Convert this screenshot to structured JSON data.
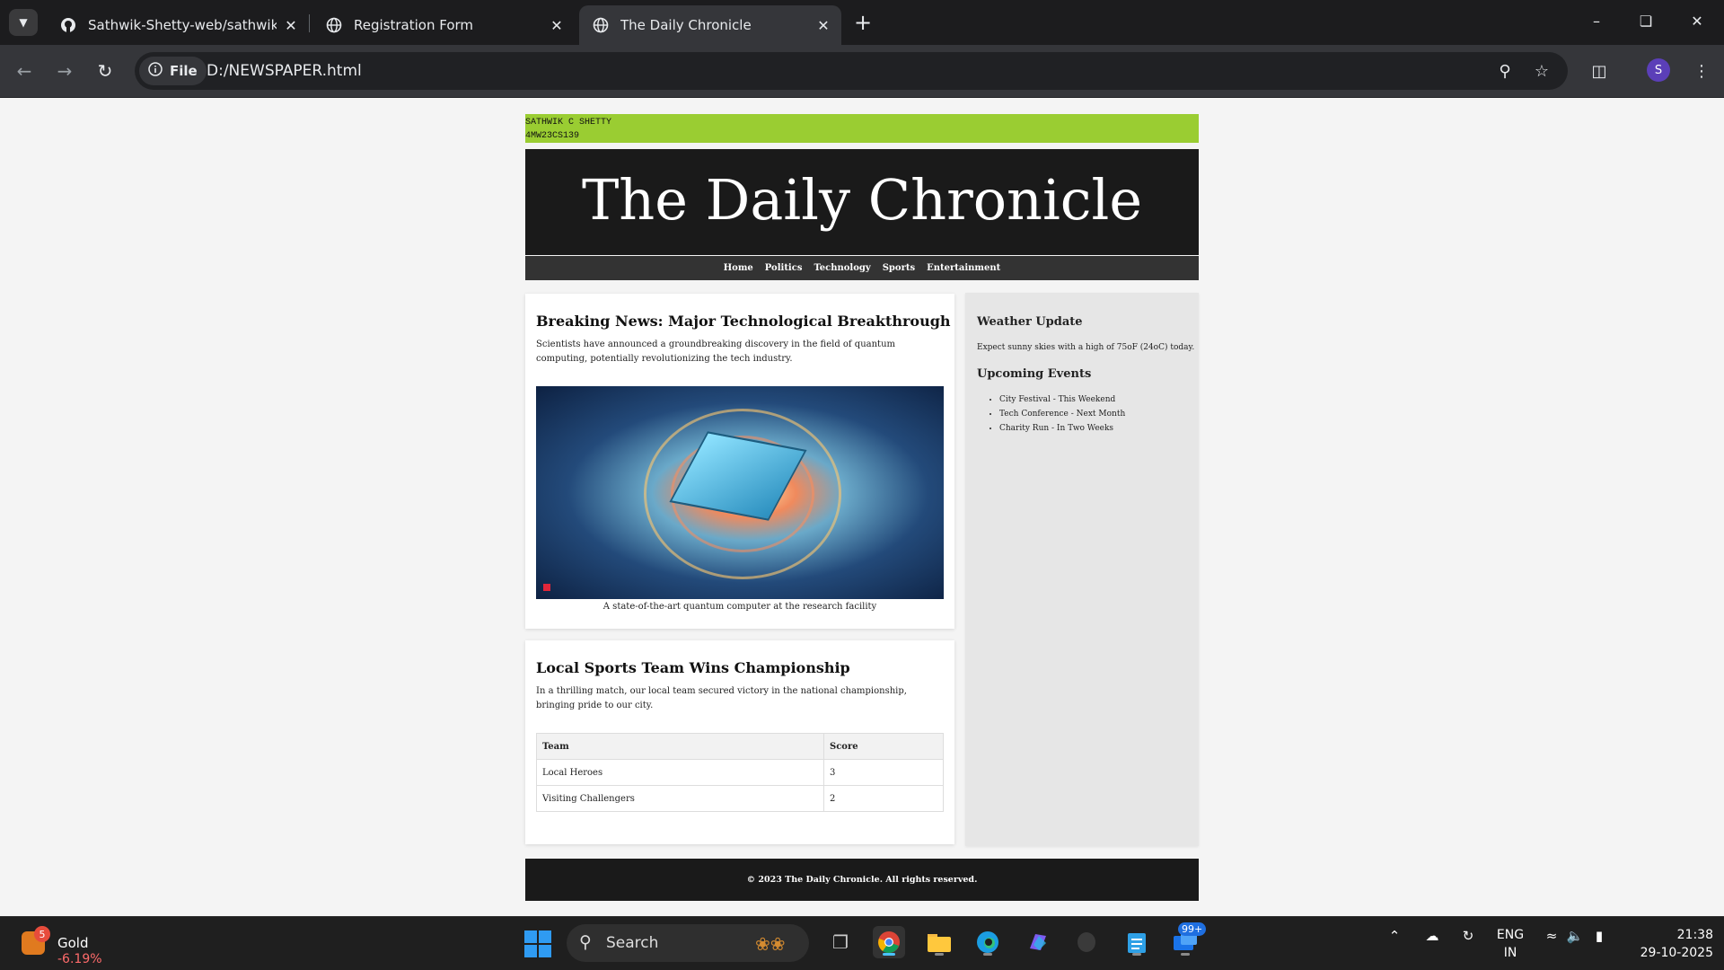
{
  "browser": {
    "tabs": [
      {
        "title": "Sathwik-Shetty-web/sathwik.htm",
        "icon": "github-icon"
      },
      {
        "title": "Registration Form",
        "icon": "globe-icon"
      },
      {
        "title": "The Daily Chronicle",
        "icon": "globe-icon",
        "active": true
      }
    ],
    "chip_label": "File",
    "url": "D:/NEWSPAPER.html",
    "profile_initial": "S"
  },
  "page": {
    "student_name": "SATHWIK C SHETTY",
    "student_id": "4MW23CS139",
    "masthead_title": "The Daily Chronicle",
    "nav": [
      "Home",
      "Politics",
      "Technology",
      "Sports",
      "Entertainment"
    ],
    "article1": {
      "heading": "Breaking News: Major Technological Breakthrough",
      "body": "Scientists have announced a groundbreaking discovery in the field of quantum computing, potentially revolutionizing the tech industry.",
      "caption": "A state-of-the-art quantum computer at the research facility"
    },
    "article2": {
      "heading": "Local Sports Team Wins Championship",
      "body": "In a thrilling match, our local team secured victory in the national championship, bringing pride to our city.",
      "table_headers": [
        "Team",
        "Score"
      ],
      "table_rows": [
        [
          "Local Heroes",
          "3"
        ],
        [
          "Visiting Challengers",
          "2"
        ]
      ]
    },
    "sidebar": {
      "weather_heading": "Weather Update",
      "weather_text": "Expect sunny skies with a high of 75oF (24oC) today.",
      "events_heading": "Upcoming Events",
      "events": [
        "City Festival - This Weekend",
        "Tech Conference - Next Month",
        "Charity Run - In Two Weeks"
      ]
    },
    "footer": "© 2023 The Daily Chronicle. All rights reserved."
  },
  "taskbar": {
    "widget_badge": "5",
    "widget_name": "Gold",
    "widget_change": "-6.19%",
    "search_label": "Search",
    "notification_badge": "99+",
    "lang_line1": "ENG",
    "lang_line2": "IN",
    "time": "21:38",
    "date": "29-10-2025"
  },
  "colors": {
    "id_bar": "#9acd32",
    "masthead_bg": "#1a1a1a",
    "nav_bg": "#333333",
    "sidebar_bg": "#e6e6e6"
  }
}
